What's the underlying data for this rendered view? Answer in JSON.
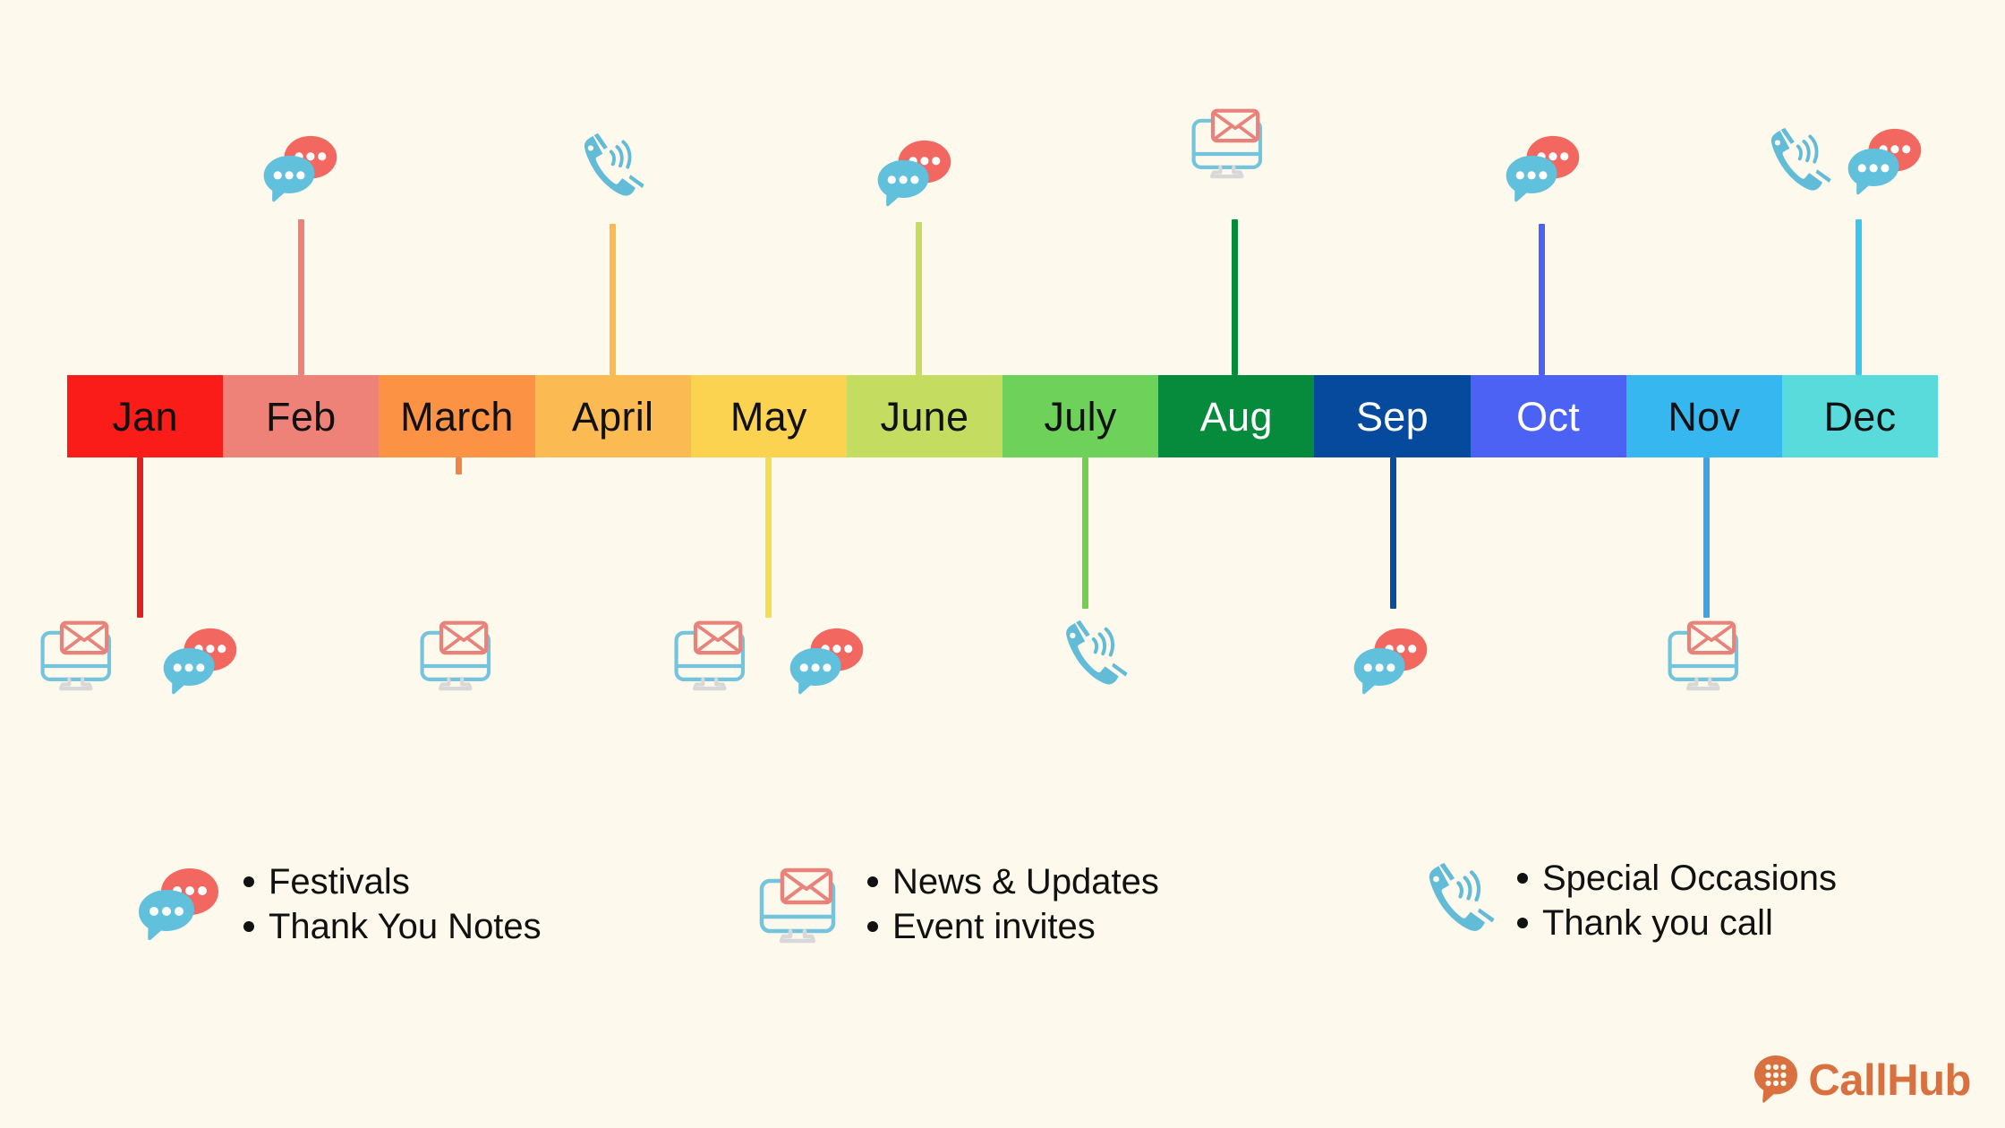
{
  "background_color": "#fdf9ec",
  "timeline": {
    "months": [
      {
        "label": "Jan",
        "color": "#f91c18",
        "text_color": "#111111"
      },
      {
        "label": "Feb",
        "color": "#ef8278",
        "text_color": "#111111"
      },
      {
        "label": "March",
        "color": "#fb9244",
        "text_color": "#111111"
      },
      {
        "label": "April",
        "color": "#fbbb52",
        "text_color": "#111111"
      },
      {
        "label": "May",
        "color": "#fcd251",
        "text_color": "#111111"
      },
      {
        "label": "June",
        "color": "#c4dd61",
        "text_color": "#111111"
      },
      {
        "label": "July",
        "color": "#6ed25a",
        "text_color": "#111111"
      },
      {
        "label": "Aug",
        "color": "#068b3d",
        "text_color": "#ffffff"
      },
      {
        "label": "Sep",
        "color": "#064a9e",
        "text_color": "#ffffff"
      },
      {
        "label": "Oct",
        "color": "#4c62f4",
        "text_color": "#ffffff"
      },
      {
        "label": "Nov",
        "color": "#36b7f0",
        "text_color": "#111111"
      },
      {
        "label": "Dec",
        "color": "#59dbdb",
        "text_color": "#111111"
      }
    ]
  },
  "touchpoints": {
    "above": [
      {
        "month": "Feb",
        "icons": [
          "chat-bubbles-icon"
        ],
        "stem_color": "#ef8278"
      },
      {
        "month": "April",
        "icons": [
          "phone-call-icon"
        ],
        "stem_color": "#fbbb52"
      },
      {
        "month": "June",
        "icons": [
          "chat-bubbles-icon"
        ],
        "stem_color": "#c4dd61"
      },
      {
        "month": "Aug",
        "icons": [
          "email-monitor-icon"
        ],
        "stem_color": "#068b3d"
      },
      {
        "month": "Oct",
        "icons": [
          "chat-bubbles-icon"
        ],
        "stem_color": "#4c62f4"
      },
      {
        "month": "Dec",
        "icons": [
          "phone-call-icon",
          "chat-bubbles-icon"
        ],
        "stem_color": "#36c8f0"
      }
    ],
    "below": [
      {
        "month": "Jan",
        "icons": [
          "email-monitor-icon",
          "chat-bubbles-icon"
        ],
        "stem_color": "#e02020"
      },
      {
        "month": "March",
        "icons": [
          "email-monitor-icon"
        ],
        "stem_color": "#f08445"
      },
      {
        "month": "May",
        "icons": [
          "email-monitor-icon",
          "chat-bubbles-icon"
        ],
        "stem_color": "#f5dd52"
      },
      {
        "month": "July",
        "icons": [
          "phone-call-icon"
        ],
        "stem_color": "#74cf4e"
      },
      {
        "month": "Sep",
        "icons": [
          "chat-bubbles-icon"
        ],
        "stem_color": "#0a4b9e"
      },
      {
        "month": "Nov",
        "icons": [
          "email-monitor-icon"
        ],
        "stem_color": "#3fa3e8"
      }
    ]
  },
  "legend": {
    "groups": [
      {
        "icon": "chat-bubbles-icon",
        "items": [
          "Festivals",
          "Thank You Notes"
        ]
      },
      {
        "icon": "email-monitor-icon",
        "items": [
          "News & Updates",
          "Event invites"
        ]
      },
      {
        "icon": "phone-call-icon",
        "items": [
          "Special Occasions",
          "Thank you call"
        ]
      }
    ]
  },
  "brand": {
    "name": "CallHub",
    "logo_icon": "callhub-dialpad-bubble-icon",
    "color": "#d9703f"
  },
  "palette": {
    "chat_red": "#f2675f",
    "chat_blue": "#61c0db",
    "envelope_salmon": "#e8837c",
    "monitor_blue": "#74c4dd",
    "monitor_stand_gray": "#d8d8d8",
    "phone_blue": "#62bcd8"
  }
}
